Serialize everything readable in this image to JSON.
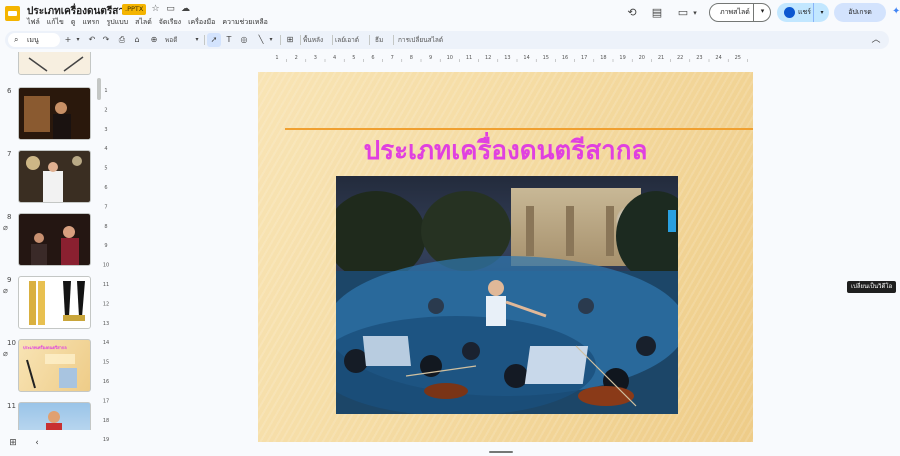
{
  "header": {
    "title": "ประเภทเครื่องดนตรีสากล",
    "badge": ".PPTX",
    "menu": [
      "ไฟล์",
      "แก้ไข",
      "ดู",
      "แทรก",
      "รูปแบบ",
      "สไลด์",
      "จัดเรียง",
      "เครื่องมือ",
      "ความช่วยเหลือ"
    ],
    "slideshow_label": "ภาพสไลด์",
    "share_label": "แชร์",
    "publish_label": "อัปเกรด"
  },
  "toolbar": {
    "menu_search": "เมนู",
    "zoom_label": "พอดี",
    "background_label": "พื้นหลัง",
    "layout_label": "เลย์เอาต์",
    "theme_label": "ธีม",
    "transition_label": "การเปลี่ยนสไลด์"
  },
  "filmstrip": {
    "slides": [
      {
        "num": "6",
        "attachment": false
      },
      {
        "num": "7",
        "attachment": false
      },
      {
        "num": "8",
        "attachment": true
      },
      {
        "num": "9",
        "attachment": true
      },
      {
        "num": "10",
        "attachment": true
      },
      {
        "num": "11",
        "attachment": false
      }
    ],
    "slide10_heading": "ประเภทเครื่องดนตรีสากล"
  },
  "ruler": {
    "top": [
      "1",
      "2",
      "3",
      "4",
      "5",
      "6",
      "7",
      "8",
      "9",
      "10",
      "11",
      "12",
      "13",
      "14",
      "15",
      "16",
      "17",
      "18",
      "19",
      "20",
      "21",
      "22",
      "23",
      "24",
      "25"
    ],
    "left": [
      "1",
      "2",
      "3",
      "4",
      "5",
      "6",
      "7",
      "8",
      "9",
      "10",
      "11",
      "12",
      "13",
      "14",
      "15",
      "16",
      "17",
      "18",
      "19"
    ]
  },
  "slide": {
    "title": "ประเภทเครื่องดนตรีสากล",
    "title_color": "#e040e0",
    "accent_line_color": "#f0a030"
  },
  "tooltip": "เปลี่ยนเป็นวิดีโอ",
  "icons": {
    "history": "history-icon",
    "comments": "comment-icon",
    "meet": "video-camera-icon"
  },
  "colors": {
    "brand_yellow": "#f4b400",
    "share_bg": "#c2e7ff",
    "publish_bg": "#d3e3fd"
  }
}
